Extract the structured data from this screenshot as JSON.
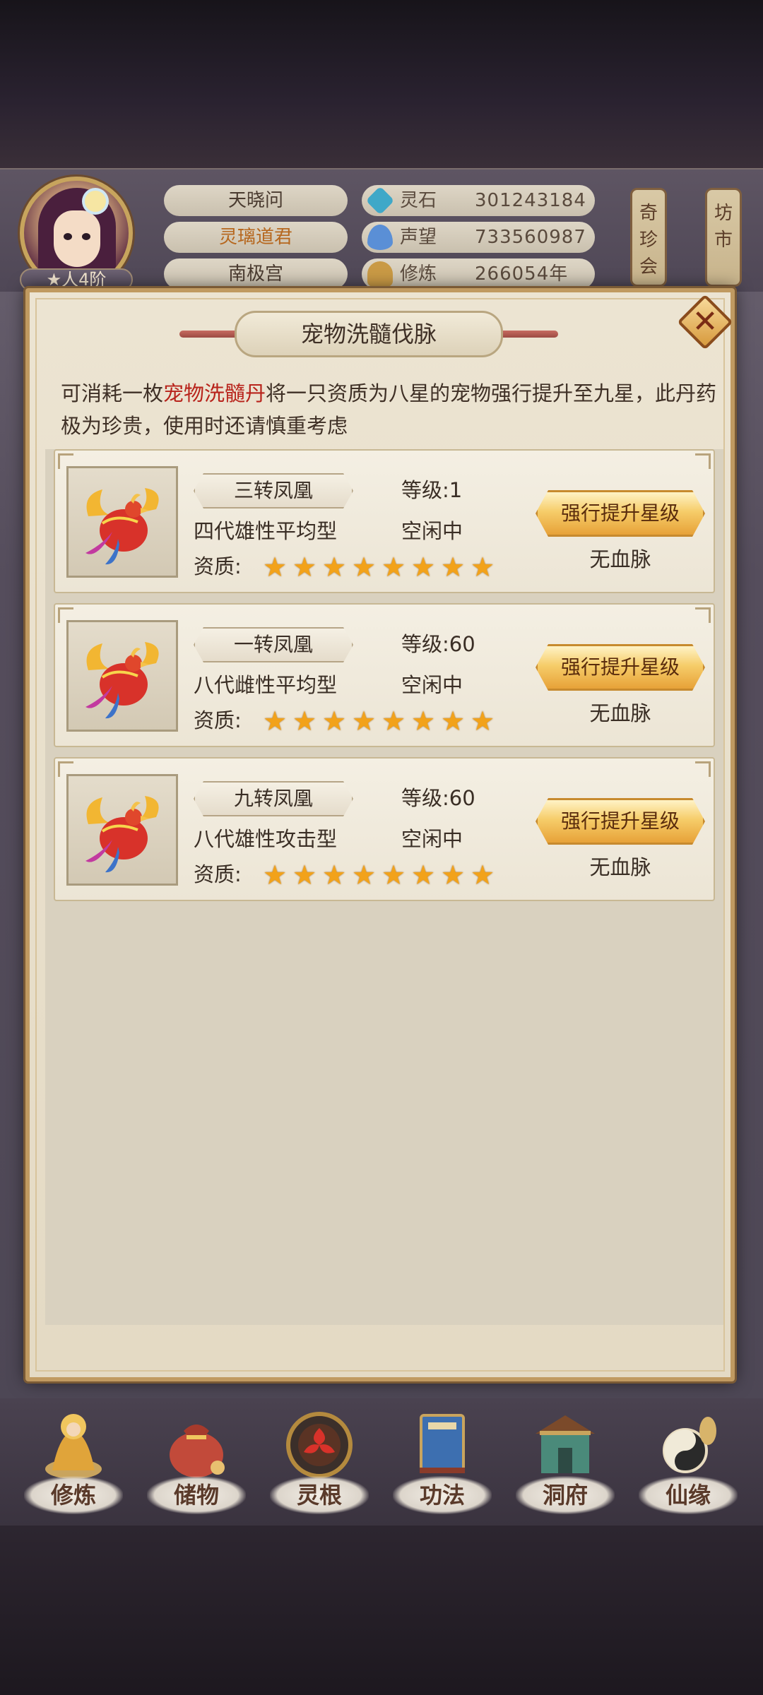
{
  "player": {
    "rank": "★人4阶",
    "names": [
      "天晓问",
      "灵璃道君",
      "南极宫"
    ]
  },
  "resources": [
    {
      "label": "灵石",
      "value": "301243184",
      "icon": "spirit-stone-icon",
      "color": "#3fa8c8"
    },
    {
      "label": "声望",
      "value": "733560987",
      "icon": "prestige-crystal-icon",
      "color": "#5a8fd6"
    },
    {
      "label": "修炼",
      "value": "266054年",
      "icon": "meditation-icon",
      "color": "#c99a45"
    }
  ],
  "side_buttons": {
    "treasure": "奇珍会",
    "market": "坊市"
  },
  "dialog": {
    "title": "宠物洗髓伐脉",
    "close_label": "✕",
    "desc_pre": "可消耗一枚",
    "desc_item": "宠物洗髓丹",
    "desc_post": "将一只资质为八星的宠物强行提升至九星，此丹药极为珍贵，使用时还请慎重考虑",
    "qual_label": "资质:",
    "pets": [
      {
        "name": "三转凤凰",
        "level": "等级:1",
        "gen_type": "四代雄性平均型",
        "status": "空闲中",
        "stars": 8,
        "button": "强行提升星级",
        "bloodline": "无血脉"
      },
      {
        "name": "一转凤凰",
        "level": "等级:60",
        "gen_type": "八代雌性平均型",
        "status": "空闲中",
        "stars": 8,
        "button": "强行提升星级",
        "bloodline": "无血脉"
      },
      {
        "name": "九转凤凰",
        "level": "等级:60",
        "gen_type": "八代雄性攻击型",
        "status": "空闲中",
        "stars": 8,
        "button": "强行提升星级",
        "bloodline": "无血脉"
      }
    ]
  },
  "bottom_nav": [
    {
      "label": "修炼",
      "icon": "cultivation-icon"
    },
    {
      "label": "储物",
      "icon": "storage-bag-icon"
    },
    {
      "label": "灵根",
      "icon": "spirit-root-icon"
    },
    {
      "label": "功法",
      "icon": "technique-book-icon"
    },
    {
      "label": "洞府",
      "icon": "cave-abode-icon"
    },
    {
      "label": "仙缘",
      "icon": "immortal-fate-icon"
    }
  ],
  "colors": {
    "highlight": "#b8231b",
    "gold": "#f6cd6a",
    "star": "#f2a21a"
  }
}
